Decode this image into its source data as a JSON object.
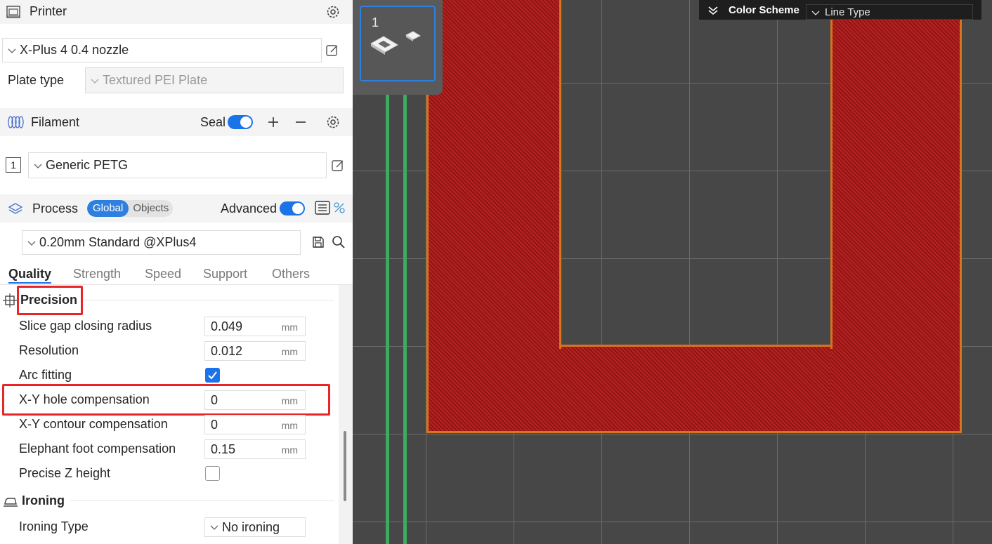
{
  "printer": {
    "title": "Printer",
    "preset": "X-Plus 4 0.4 nozzle",
    "plate_label": "Plate type",
    "plate_value": "Textured PEI Plate"
  },
  "filament": {
    "title": "Filament",
    "seal_label": "Seal",
    "slot_index": "1",
    "preset": "Generic PETG"
  },
  "process": {
    "title": "Process",
    "global_label": "Global",
    "objects_label": "Objects",
    "advanced_label": "Advanced",
    "preset": "0.20mm Standard @XPlus4"
  },
  "tabs": [
    "Quality",
    "Strength",
    "Speed",
    "Support",
    "Others"
  ],
  "precision": {
    "title": "Precision",
    "rows": [
      {
        "label": "Slice gap closing radius",
        "value": "0.049",
        "unit": "mm"
      },
      {
        "label": "Resolution",
        "value": "0.012",
        "unit": "mm"
      },
      {
        "label": "Arc fitting",
        "checked": true
      },
      {
        "label": "X-Y hole compensation",
        "value": "0",
        "unit": "mm"
      },
      {
        "label": "X-Y contour compensation",
        "value": "0",
        "unit": "mm"
      },
      {
        "label": "Elephant foot compensation",
        "value": "0.15",
        "unit": "mm"
      },
      {
        "label": "Precise Z height",
        "checked": false
      }
    ]
  },
  "ironing": {
    "title": "Ironing",
    "type_label": "Ironing Type",
    "type_value": "No ironing"
  },
  "viewport": {
    "plate_number": "1",
    "legend_title": "Color Scheme",
    "legend_value": "Line Type"
  },
  "colors": {
    "accent": "#1a73e8",
    "highlight": "#e8262a",
    "infill": "#b31e1e",
    "perimeter": "#d9731c",
    "travel": "#3caa5f"
  }
}
